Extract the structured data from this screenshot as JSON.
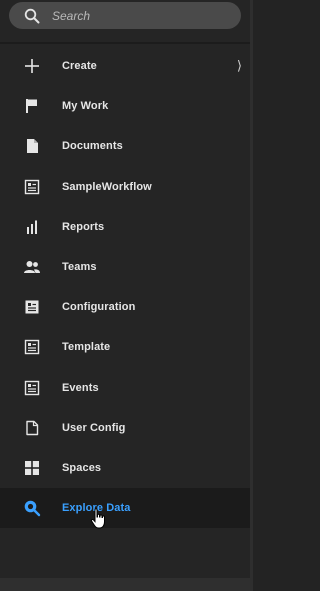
{
  "search": {
    "placeholder": "Search"
  },
  "menu": {
    "items": [
      {
        "label": "Create",
        "icon": "plus-icon",
        "has_submenu": true
      },
      {
        "label": "My Work",
        "icon": "flag-icon"
      },
      {
        "label": "Documents",
        "icon": "document-icon"
      },
      {
        "label": "SampleWorkflow",
        "icon": "form-icon"
      },
      {
        "label": "Reports",
        "icon": "bar-chart-icon"
      },
      {
        "label": "Teams",
        "icon": "people-icon"
      },
      {
        "label": "Configuration",
        "icon": "form-icon"
      },
      {
        "label": "Template",
        "icon": "form-icon"
      },
      {
        "label": "Events",
        "icon": "form-icon"
      },
      {
        "label": "User Config",
        "icon": "document-outline-icon"
      },
      {
        "label": "Spaces",
        "icon": "grid-icon"
      },
      {
        "label": "Explore Data",
        "icon": "explore-icon",
        "active": true
      }
    ],
    "submenu_glyph": "⟩"
  },
  "colors": {
    "background": "#252525",
    "active_background": "#1b1b1b",
    "active_text": "#3aa0ff",
    "text": "#e6e6e6",
    "search_background": "#4a4a4a"
  }
}
